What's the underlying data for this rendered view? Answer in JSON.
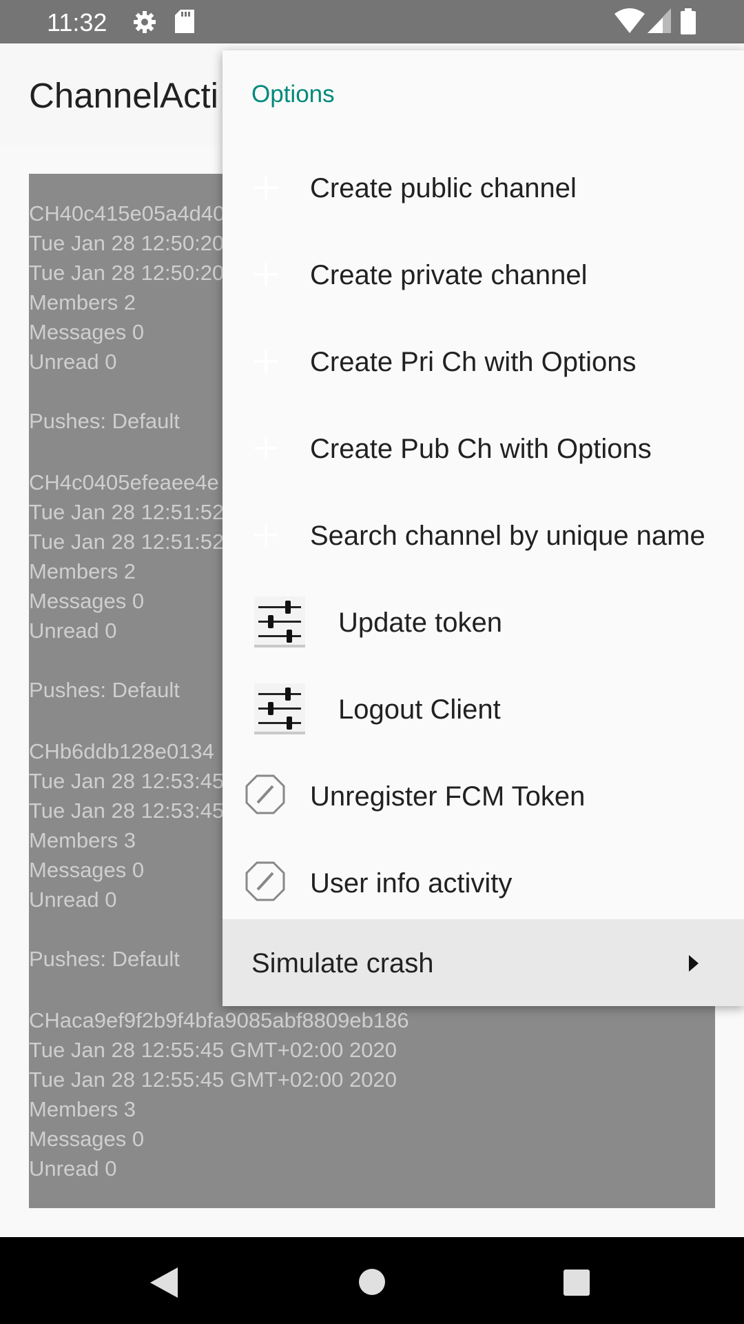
{
  "status_bar": {
    "time": "11:32",
    "icons": [
      "gear-icon",
      "sd-card-icon",
      "wifi-icon",
      "signal-icon",
      "battery-icon"
    ]
  },
  "app_bar": {
    "title": "ChannelActi"
  },
  "channels": [
    {
      "sid": "CH40c415e05a4d40",
      "created": "Tue Jan 28 12:50:20",
      "updated": "Tue Jan 28 12:50:20",
      "members": "Members 2",
      "messages": "Messages 0",
      "unread": "Unread 0",
      "pushes": "Pushes: Default"
    },
    {
      "sid": "CH4c0405efeaee4e",
      "created": "Tue Jan 28 12:51:52",
      "updated": "Tue Jan 28 12:51:52",
      "members": "Members 2",
      "messages": "Messages 0",
      "unread": "Unread 0",
      "pushes": "Pushes: Default"
    },
    {
      "sid": "CHb6ddb128e0134",
      "created": "Tue Jan 28 12:53:45",
      "updated": "Tue Jan 28 12:53:45",
      "members": "Members 3",
      "messages": "Messages 0",
      "unread": "Unread 0",
      "pushes": "Pushes: Default"
    },
    {
      "sid": "CHaca9ef9f2b9f4bfa9085abf8809eb186",
      "created": "Tue Jan 28 12:55:45 GMT+02:00 2020",
      "updated": "Tue Jan 28 12:55:45 GMT+02:00 2020",
      "members": "Members 3",
      "messages": "Messages 0",
      "unread": "Unread 0",
      "pushes": ""
    }
  ],
  "menu": {
    "header": "Options",
    "items": [
      {
        "label": "Create public channel",
        "icon": "plus-icon"
      },
      {
        "label": "Create private channel",
        "icon": "plus-icon"
      },
      {
        "label": "Create Pri Ch with Options",
        "icon": "plus-icon"
      },
      {
        "label": "Create Pub Ch with Options",
        "icon": "plus-icon"
      },
      {
        "label": "Search channel by unique name",
        "icon": "plus-icon"
      },
      {
        "label": "Update token",
        "icon": "sliders-icon"
      },
      {
        "label": "Logout Client",
        "icon": "sliders-icon"
      },
      {
        "label": "Unregister FCM Token",
        "icon": "edit-octagon-icon"
      },
      {
        "label": "User info activity",
        "icon": "edit-octagon-icon"
      },
      {
        "label": "Simulate crash",
        "icon": "submenu-arrow-icon"
      }
    ]
  },
  "nav_bar": {
    "icons": [
      "back-icon",
      "home-icon",
      "recents-icon"
    ]
  }
}
